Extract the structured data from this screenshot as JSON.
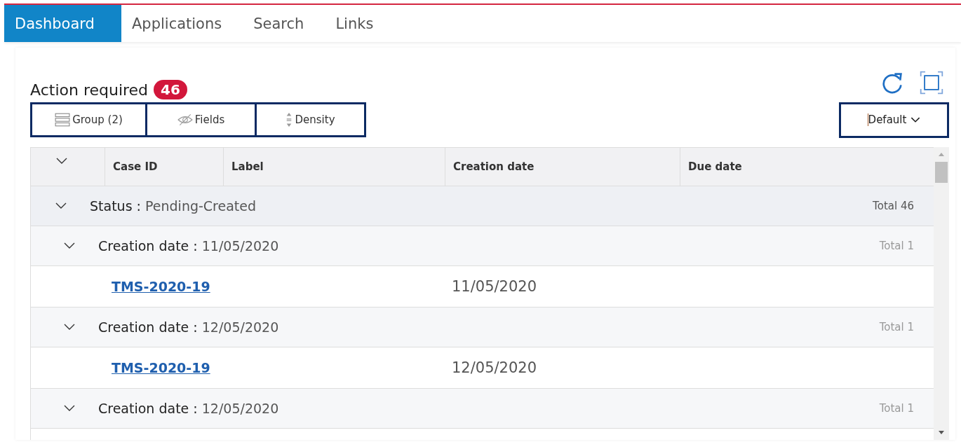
{
  "tabs": [
    {
      "label": "Dashboard",
      "selected": true
    },
    {
      "label": "Applications",
      "selected": false
    },
    {
      "label": "Search",
      "selected": false
    },
    {
      "label": "Links",
      "selected": false
    }
  ],
  "panel": {
    "title": "Action required",
    "count": "46",
    "toolbar": [
      {
        "kind": "group",
        "label": "Group (2)"
      },
      {
        "kind": "fields",
        "label": "Fields"
      },
      {
        "kind": "density",
        "label": "Density"
      }
    ],
    "view_select": {
      "value": "Default"
    }
  },
  "table": {
    "columns": [
      "Case ID",
      "Label",
      "Creation date",
      "Due date"
    ],
    "groups": [
      {
        "field": "Status :",
        "value": "Pending-Created",
        "total": "Total 46",
        "expanded": true,
        "children": [
          {
            "field": "Creation date :",
            "value": "11/05/2020",
            "total": "Total 1",
            "expanded": true,
            "rows": [
              {
                "case_id": "TMS-2020-19",
                "label": "",
                "creation_date": "11/05/2020",
                "due_date": ""
              }
            ]
          },
          {
            "field": "Creation date :",
            "value": "12/05/2020",
            "total": "Total 1",
            "expanded": true,
            "rows": [
              {
                "case_id": "TMS-2020-19",
                "label": "",
                "creation_date": "12/05/2020",
                "due_date": ""
              }
            ]
          },
          {
            "field": "Creation date :",
            "value": "12/05/2020",
            "total": "Total 1",
            "expanded": true
          }
        ]
      }
    ]
  }
}
